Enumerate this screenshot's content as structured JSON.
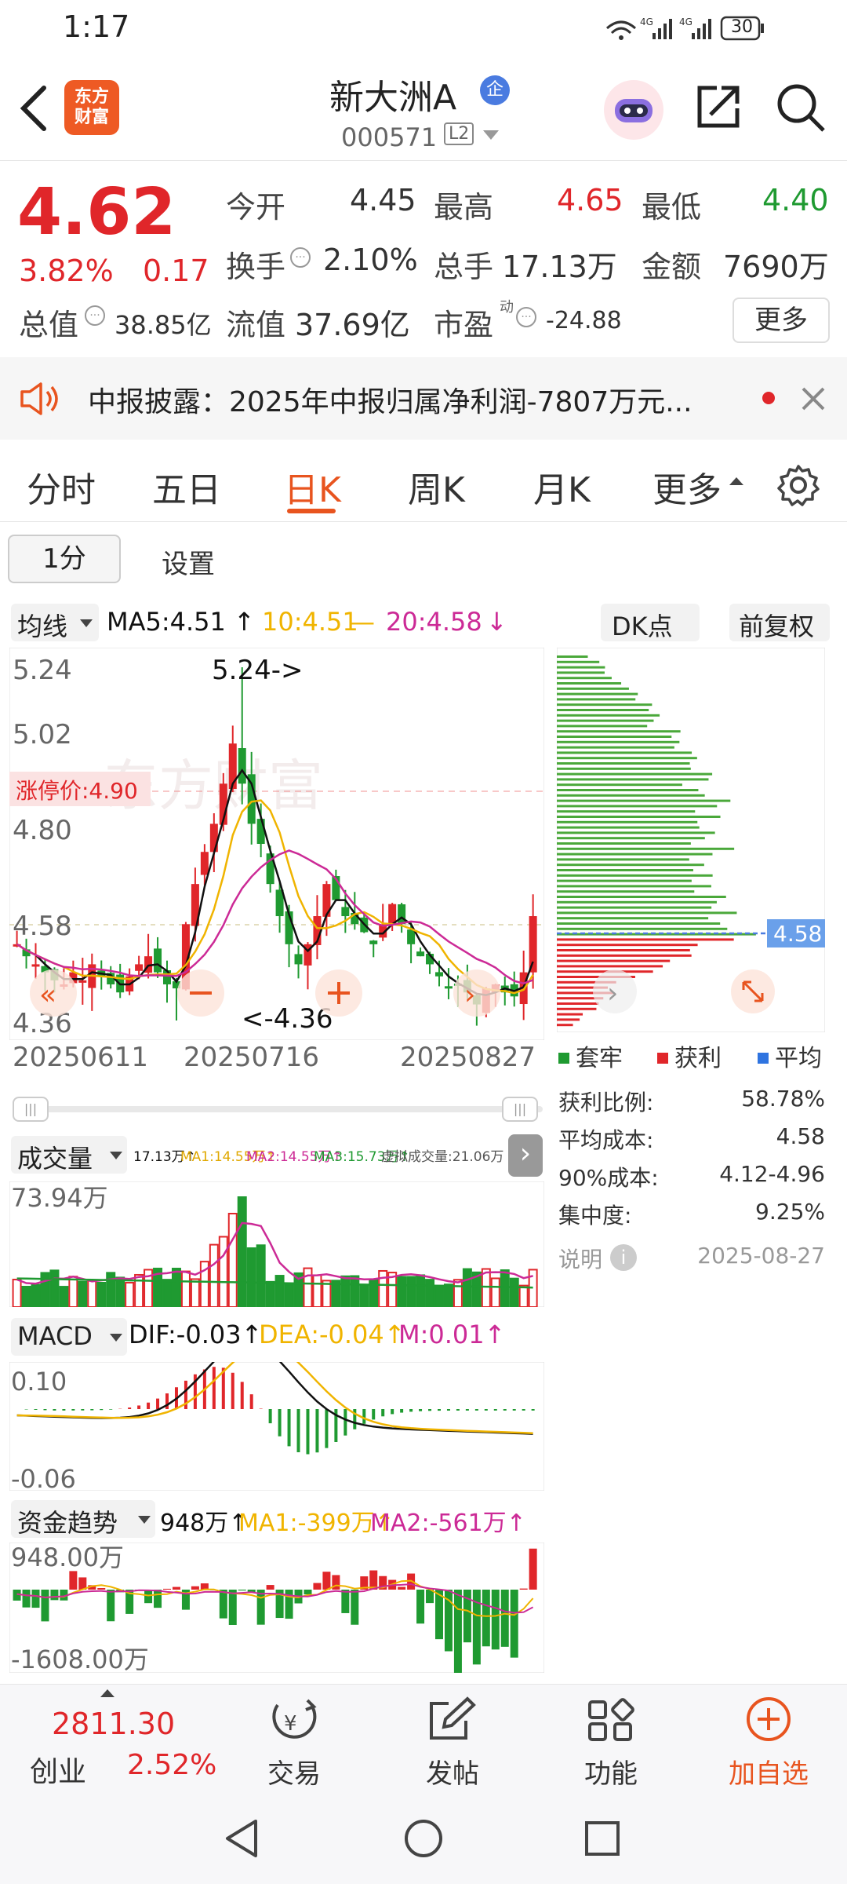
{
  "status": {
    "time": "1:17",
    "battery": "30",
    "net1": "4G",
    "net2": "4G"
  },
  "header": {
    "name": "新大洲A",
    "badge": "企",
    "code": "000571",
    "level": "L2",
    "brand_line1": "东方",
    "brand_line2": "财富"
  },
  "quote": {
    "price": "4.62",
    "change_pct": "3.82%",
    "change_amt": "0.17",
    "open_label": "今开",
    "open": "4.45",
    "high_label": "最高",
    "high": "4.65",
    "low_label": "最低",
    "low": "4.40",
    "turnover_label": "换手",
    "turnover": "2.10%",
    "volume_label": "总手",
    "volume": "17.13万",
    "amount_label": "金额",
    "amount": "7690万",
    "mktcap_label": "总值",
    "mktcap": "38.85亿",
    "float_label": "流值",
    "float": "37.69亿",
    "pe_label": "市盈",
    "pe_sup": "动",
    "pe": "-24.88",
    "more": "更多"
  },
  "notice": {
    "text": "中报披露：2025年中报归属净利润-7807万元..."
  },
  "tabs": [
    "分时",
    "五日",
    "日K",
    "周K",
    "月K",
    "更多"
  ],
  "active_tab": "日K",
  "subtabs": {
    "period": "1分",
    "settings": "设置"
  },
  "kline": {
    "ma_selector": "均线",
    "ma5": "MA5:4.51",
    "ma10": "10:4.51",
    "ma20": "20:4.58",
    "dk": "DK点",
    "adjust": "前复权",
    "y_ticks": [
      "5.24",
      "5.02",
      "4.80",
      "4.58",
      "4.36"
    ],
    "limit_label": "涨停价:4.90",
    "high_mark": "5.24->",
    "low_mark": "<-4.36",
    "dates": [
      "20250611",
      "20250716",
      "20250827"
    ],
    "watermark": "东方财富"
  },
  "chip": {
    "avg_price_tag": "4.58",
    "legend": [
      "套牢",
      "获利",
      "平均"
    ],
    "rows": [
      {
        "label": "获利比例:",
        "value": "58.78%"
      },
      {
        "label": "平均成本:",
        "value": "4.58"
      },
      {
        "label": "90%成本:",
        "value": "4.12-4.96"
      },
      {
        "label": "集中度:",
        "value": "9.25%"
      }
    ],
    "note": "说明",
    "date": "2025-08-27"
  },
  "volume": {
    "selector": "成交量",
    "info": "17.13万↑",
    "ma1": "MA1:14.55万↑",
    "ma2": "MA2:14.55万↑",
    "ma3": "MA3:15.73万↑",
    "virtual": "虚拟成交量:21.06万",
    "max": "73.94万"
  },
  "macd": {
    "selector": "MACD",
    "dif": "DIF:-0.03↑",
    "dea": "DEA:-0.04↑",
    "m": "M:0.01↑",
    "top": "0.10",
    "bottom": "-0.06"
  },
  "fund": {
    "selector": "资金趋势",
    "val": "948万↑",
    "ma1": "MA1:-399万↑",
    "ma2": "MA2:-561万↑",
    "top": "948.00万",
    "bottom": "-1608.00万"
  },
  "bottomnav": {
    "index_value": "2811.30",
    "index_name": "创业",
    "index_pct": "2.52%",
    "trade": "交易",
    "post": "发帖",
    "func": "功能",
    "add": "加自选"
  },
  "colors": {
    "up": "#e0262a",
    "down": "#1f9a31",
    "ma5": "#111111",
    "ma10": "#f0b400",
    "ma20": "#cc2a96",
    "accent": "#e8541f"
  }
}
